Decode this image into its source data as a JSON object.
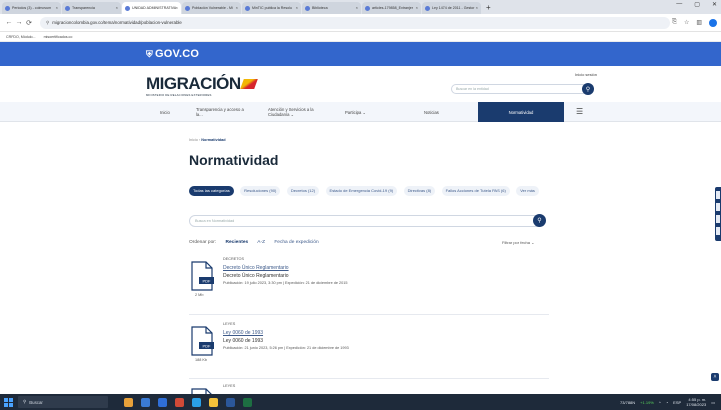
{
  "browser": {
    "tabs": [
      {
        "label": "Periodos (3) - colmovum",
        "active": false
      },
      {
        "label": "Transparencia",
        "active": false
      },
      {
        "label": "UNIDAD ADMINISTRATIVA",
        "active": true
      },
      {
        "label": "Población Vulnerable - Mi",
        "active": false
      },
      {
        "label": "MinTIC publica la Resolu",
        "active": false
      },
      {
        "label": "Biblioteca",
        "active": false
      },
      {
        "label": "articles-179858_Extranjer",
        "active": false
      },
      {
        "label": "Ley 1474 de 2011 - Gestor",
        "active": false
      }
    ],
    "new_tab": "+",
    "url": "migracioncolombia.gov.co/tema/normatividad/poblacion-vulnerable",
    "bookmarks": [
      "CRFDO, Módulo...",
      "misoertificados.co"
    ],
    "window_controls": [
      "—",
      "▢",
      "✕"
    ]
  },
  "gov": {
    "logo": "GOV.CO",
    "shield": "⛨"
  },
  "header": {
    "logo_text": "MIGRACIÓN",
    "logo_subtitle": "MINISTERIO DE RELACIONES EXTERIORES",
    "login": "Inicio sesión",
    "search_placeholder": "Buscar en la entidad"
  },
  "nav": {
    "items": [
      {
        "label": "Inicio"
      },
      {
        "label": "Transparencia y acceso a la..."
      },
      {
        "label": "Atención y Servicios a la Ciudadanía ⌄"
      },
      {
        "label": "Participa ⌄"
      },
      {
        "label": "Noticias"
      },
      {
        "label": "Normatividad"
      }
    ],
    "menu_icon": "☰"
  },
  "breadcrumb": {
    "home": "Inicio",
    "sep": "›",
    "current": "Normatividad"
  },
  "page_title": "Normatividad",
  "chips": [
    "Todas las categorías",
    "Resoluciones (90)",
    "Decretos (12)",
    "Estado de Emergencia Covid-19 (9)",
    "Directivas (8)",
    "Fallos Acciones de Tutela PAS (6)",
    "Ver más"
  ],
  "content_search": {
    "placeholder": "Busca en Normatividad"
  },
  "sort": {
    "label": "Ordenar por:",
    "options": [
      "Recientes",
      "A-Z",
      "Fecha de expedición"
    ],
    "filter": "Filtrar por fecha ⌄"
  },
  "documents": [
    {
      "category": "DECRETOS",
      "link": "Decreto Único Reglamentario",
      "name": "Decreto Único Reglamentario",
      "meta": "Publicación: 19 julio 2023, 3:30 pm  |  Expedición: 21 de diciembre de 2015",
      "size": "2 Mb",
      "file_type": "PDF"
    },
    {
      "category": "LEYES",
      "link": "Ley 0060 de 1993",
      "name": "Ley 0060 de 1993",
      "meta": "Publicación: 21 junio 2023, 5:26 pm  |  Expedición: 21 de diciembre de 1993",
      "size": "188 Kb",
      "file_type": "PDF"
    },
    {
      "category": "LEYES",
      "link": "",
      "name": "",
      "meta": "",
      "size": "",
      "file_type": ""
    }
  ],
  "taskbar": {
    "search": "Buscar",
    "ticker": "73/788N",
    "ticker_change": "+1.19%",
    "lang": "ESP",
    "time": "4:55 p. m.",
    "date": "17/08/2023"
  },
  "colors": {
    "gov_blue": "#3366cc",
    "navy": "#1a3b6e",
    "link": "#3d5a8a"
  }
}
